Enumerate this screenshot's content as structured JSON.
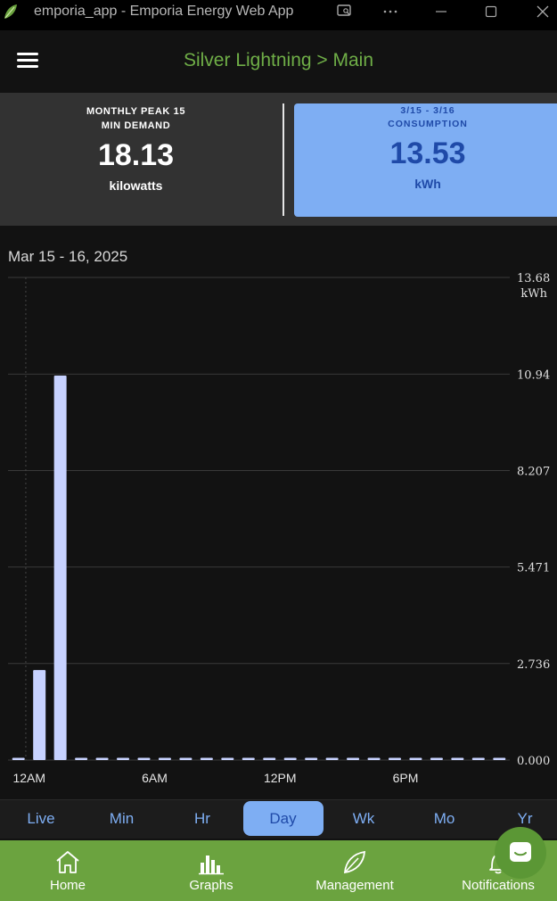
{
  "window": {
    "title": "emporia_app - Emporia Energy Web App",
    "icons": [
      "app-leaf-icon",
      "cast-icon",
      "more-icon",
      "minimize-icon",
      "maximize-icon",
      "close-icon"
    ]
  },
  "header": {
    "breadcrumb": "Silver Lightning > Main"
  },
  "stats": {
    "peak": {
      "caption_line1": "MONTHLY PEAK 15",
      "caption_line2": "MIN DEMAND",
      "value": "18.13",
      "unit": "kilowatts"
    },
    "consumption": {
      "date_range": "3/15 - 3/16",
      "caption": "CONSUMPTION",
      "value": "13.53",
      "unit": "kWh"
    }
  },
  "chart_data": {
    "type": "bar",
    "date_label": "Mar 15 - 16, 2025",
    "ylabel": "kWh",
    "ylim": [
      0,
      13.68
    ],
    "y_ticks": [
      "0.000",
      "2.736",
      "5.471",
      "8.207",
      "10.94",
      "13.68"
    ],
    "y_tick_values": [
      0,
      2.736,
      5.471,
      8.207,
      10.94,
      13.68
    ],
    "x_tick_labels": [
      "12AM",
      "6AM",
      "12PM",
      "6PM"
    ],
    "x_tick_hours": [
      0,
      6,
      12,
      18
    ],
    "grid": true,
    "bar_color": "#c7d2ff",
    "bars": [
      {
        "hour": 0,
        "value": 0
      },
      {
        "hour": 1,
        "value": 2.55
      },
      {
        "hour": 2,
        "value": 10.9
      },
      {
        "hour": 3,
        "value": 0
      },
      {
        "hour": 4,
        "value": 0
      },
      {
        "hour": 5,
        "value": 0
      },
      {
        "hour": 6,
        "value": 0
      },
      {
        "hour": 7,
        "value": 0
      },
      {
        "hour": 8,
        "value": 0
      },
      {
        "hour": 9,
        "value": 0
      },
      {
        "hour": 10,
        "value": 0
      },
      {
        "hour": 11,
        "value": 0
      },
      {
        "hour": 12,
        "value": 0
      },
      {
        "hour": 13,
        "value": 0
      },
      {
        "hour": 14,
        "value": 0
      },
      {
        "hour": 15,
        "value": 0
      },
      {
        "hour": 16,
        "value": 0
      },
      {
        "hour": 17,
        "value": 0
      },
      {
        "hour": 18,
        "value": 0
      },
      {
        "hour": 19,
        "value": 0
      },
      {
        "hour": 20,
        "value": 0
      },
      {
        "hour": 21,
        "value": 0
      },
      {
        "hour": 22,
        "value": 0
      },
      {
        "hour": 23,
        "value": 0
      }
    ]
  },
  "range_tabs": {
    "items": [
      "Live",
      "Min",
      "Hr",
      "Day",
      "Wk",
      "Mo",
      "Yr"
    ],
    "selected": "Day"
  },
  "bottom_nav": {
    "items": [
      {
        "label": "Home",
        "icon": "home-icon"
      },
      {
        "label": "Graphs",
        "icon": "bar-chart-icon"
      },
      {
        "label": "Management",
        "icon": "leaf-icon"
      },
      {
        "label": "Notifications",
        "icon": "bell-icon"
      }
    ]
  },
  "colors": {
    "brand_green": "#6ba33f",
    "accent_blue": "#7eaef3",
    "accent_blue_text": "#1f4aa8",
    "background": "#121212"
  }
}
